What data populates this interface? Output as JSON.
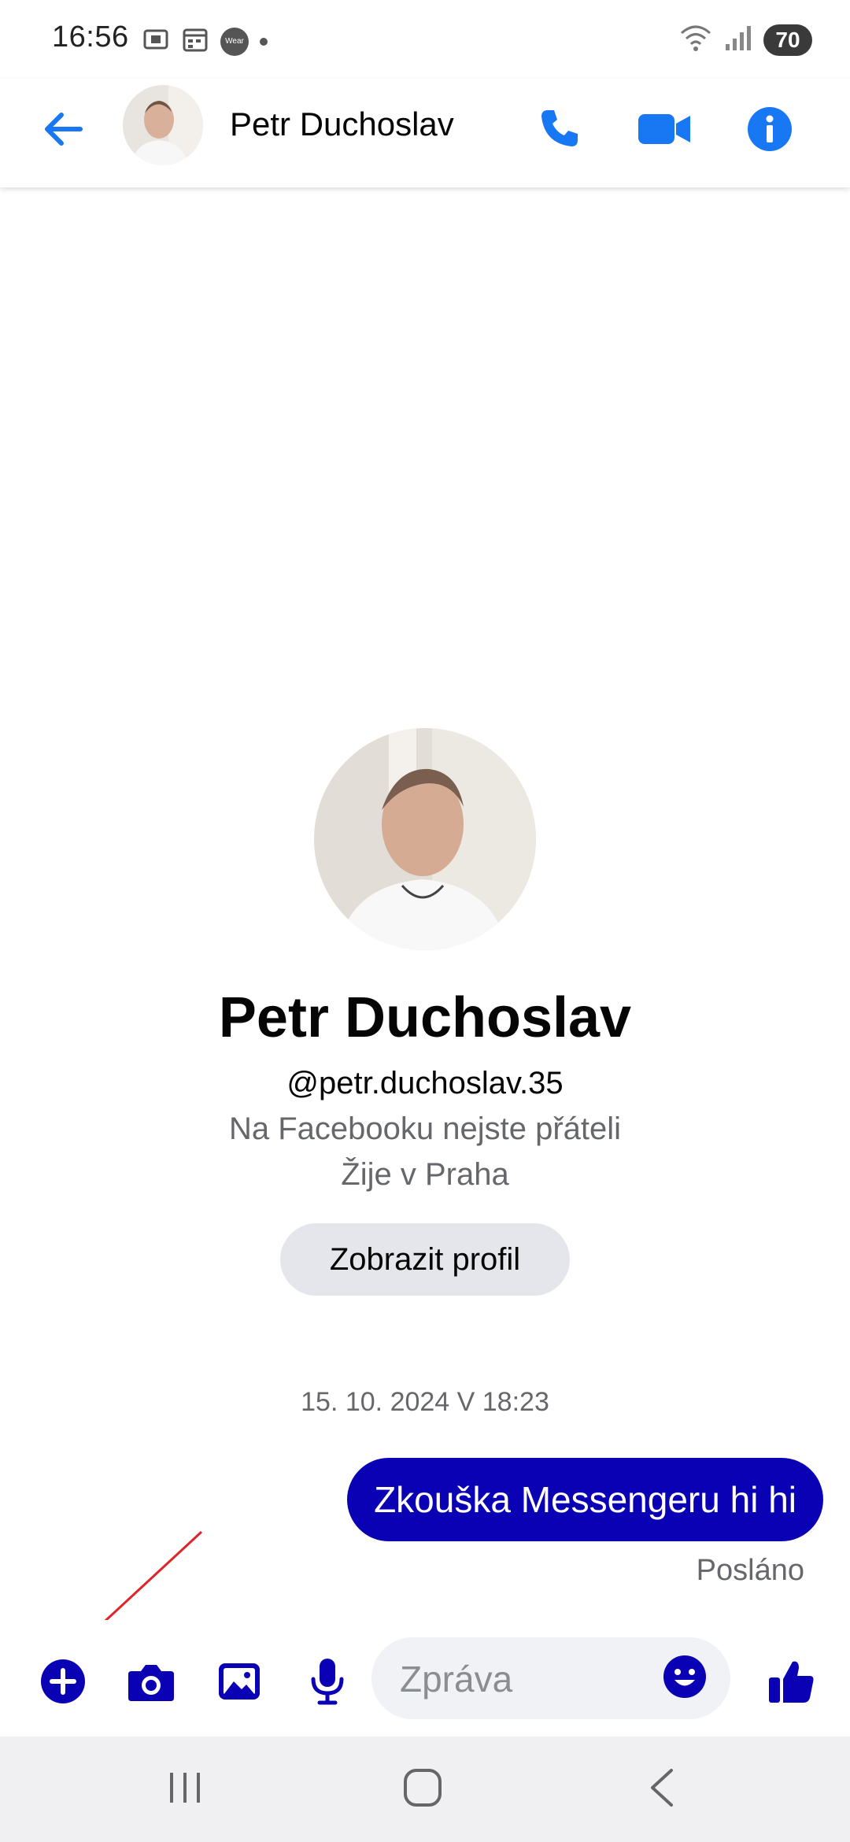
{
  "status_bar": {
    "time": "16:56",
    "wear_label": "Wear",
    "battery": "70"
  },
  "header": {
    "contact_name": "Petr Duchoslav",
    "icons": [
      "back-arrow-icon",
      "phone-icon",
      "video-camera-icon",
      "info-icon"
    ]
  },
  "profile": {
    "name": "Petr Duchoslav",
    "username": "@petr.duchoslav.35",
    "friend_status": "Na Facebooku nejste přáteli",
    "location": "Žije v Praha",
    "view_profile_label": "Zobrazit profil"
  },
  "conversation": {
    "timestamp": "15. 10. 2024 V 18:23",
    "messages": [
      {
        "text": "Zkouška Messengeru hi hi",
        "status": "Posláno"
      }
    ]
  },
  "composer": {
    "placeholder": "Zpráva",
    "icons": [
      "plus-icon",
      "camera-icon",
      "gallery-icon",
      "microphone-icon",
      "emoji-icon",
      "thumbs-up-icon"
    ]
  },
  "colors": {
    "accent": "#1877f2",
    "composer_accent": "#0a00b4",
    "bubble": "#0a00b4",
    "annotation": "#e0242a"
  }
}
